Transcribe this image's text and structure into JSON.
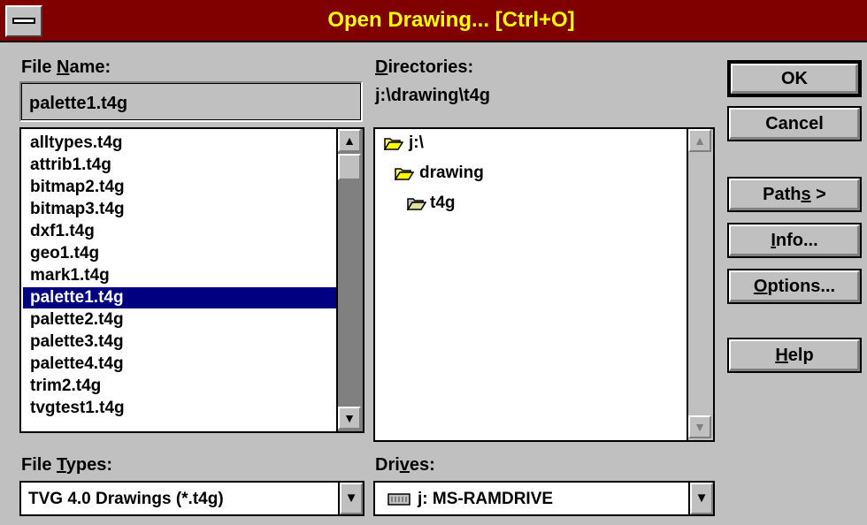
{
  "window": {
    "title": "Open Drawing... [Ctrl+O]"
  },
  "file_name": {
    "label": "File Name:",
    "value": "palette1.t4g",
    "files": [
      "alltypes.t4g",
      "attrib1.t4g",
      "bitmap2.t4g",
      "bitmap3.t4g",
      "dxf1.t4g",
      "geo1.t4g",
      "mark1.t4g",
      "palette1.t4g",
      "palette2.t4g",
      "palette3.t4g",
      "palette4.t4g",
      "trim2.t4g",
      "tvgtest1.t4g"
    ],
    "selected_index": 7
  },
  "directories": {
    "label": "Directories:",
    "current_path": "j:\\drawing\\t4g",
    "tree": [
      "j:\\",
      "drawing",
      "t4g"
    ]
  },
  "file_types": {
    "label": "File Types:",
    "value": "TVG 4.0 Drawings (*.t4g)"
  },
  "drives": {
    "label": "Drives:",
    "value": "j: MS-RAMDRIVE"
  },
  "buttons": {
    "ok": "OK",
    "cancel": "Cancel",
    "paths": "Paths >",
    "info": "Info...",
    "options": "Options...",
    "help": "Help"
  },
  "colors": {
    "titlebar": "#800000",
    "title_text": "#ffff00",
    "selection": "#000080",
    "face": "#c0c0c0"
  }
}
